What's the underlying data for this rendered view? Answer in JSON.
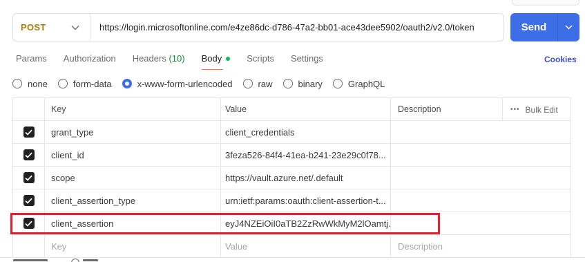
{
  "request": {
    "method": "POST",
    "url": "https://login.microsoftonline.com/e4ze86dc-d786-47a2-bb01-ace43dee5902/oauth2/v2.0/token",
    "send_label": "Send"
  },
  "tabs": {
    "params": "Params",
    "authorization": "Authorization",
    "headers": "Headers",
    "headers_count": "(10)",
    "body": "Body",
    "scripts": "Scripts",
    "settings": "Settings",
    "cookies": "Cookies"
  },
  "body_types": {
    "none": "none",
    "form_data": "form-data",
    "urlencoded": "x-www-form-urlencoded",
    "raw": "raw",
    "binary": "binary",
    "graphql": "GraphQL",
    "selected": "x-www-form-urlencoded"
  },
  "table": {
    "headers": {
      "key": "Key",
      "value": "Value",
      "description": "Description",
      "bulk_edit": "Bulk Edit"
    },
    "rows": [
      {
        "checked": true,
        "key": "grant_type",
        "value": "client_credentials",
        "description": ""
      },
      {
        "checked": true,
        "key": "client_id",
        "value": "3feza526-84f4-41ea-b241-23e29c0f78...",
        "description": ""
      },
      {
        "checked": true,
        "key": "scope",
        "value": "https://vault.azure.net/.default",
        "description": ""
      },
      {
        "checked": true,
        "key": "client_assertion_type",
        "value": "urn:ietf:params:oauth:client-assertion-t...",
        "description": ""
      },
      {
        "checked": true,
        "key": "client_assertion",
        "value": "eyJ4NZEiOiI0aTB2ZzRwWkMyM2lOamtj...",
        "description": ""
      }
    ],
    "placeholder": {
      "key": "Key",
      "value": "Value",
      "description": "Description"
    }
  },
  "colors": {
    "method": "#ad7a03",
    "send": "#3d6ee8",
    "active_tab_underline": "#ff6c37",
    "body_dot": "#0cbb52",
    "highlight": "#e0202e"
  }
}
